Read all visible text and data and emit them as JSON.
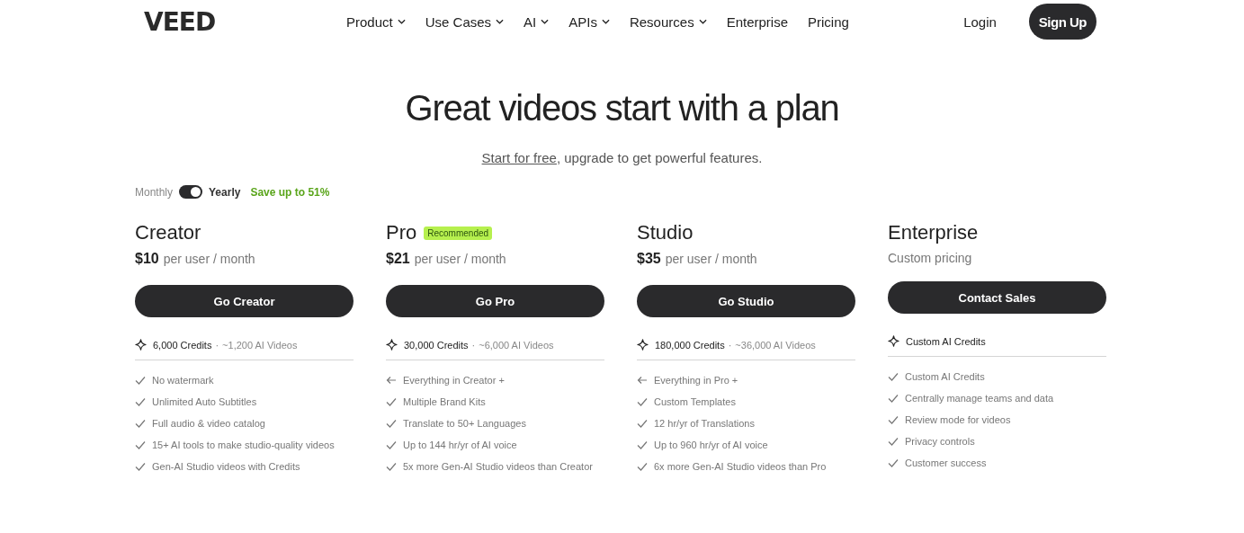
{
  "header": {
    "logo": "VEED",
    "nav": [
      {
        "label": "Product",
        "has_menu": true
      },
      {
        "label": "Use Cases",
        "has_menu": true
      },
      {
        "label": "AI",
        "has_menu": true
      },
      {
        "label": "APIs",
        "has_menu": true
      },
      {
        "label": "Resources",
        "has_menu": true
      },
      {
        "label": "Enterprise",
        "has_menu": false
      },
      {
        "label": "Pricing",
        "has_menu": false
      }
    ],
    "login": "Login",
    "signup": "Sign Up"
  },
  "hero": {
    "title": "Great videos start with a plan",
    "link": "Start for free",
    "subtitle_rest": ", upgrade to get powerful features."
  },
  "billing": {
    "monthly_label": "Monthly",
    "yearly_label": "Yearly",
    "yearly": true,
    "savings": "Save up to 51%"
  },
  "plans": [
    {
      "name": "Creator",
      "price": "$10",
      "price_unit": "per user / month",
      "button": "Go Creator",
      "credits": "6,000 Credits",
      "separator": "·",
      "videos": "~1,200 AI Videos",
      "features": [
        {
          "kind": "check",
          "text": "No watermark"
        },
        {
          "kind": "check",
          "text": "Unlimited Auto Subtitles"
        },
        {
          "kind": "check",
          "text": "Full audio & video catalog"
        },
        {
          "kind": "check",
          "text": "15+ AI tools to make studio-quality videos"
        },
        {
          "kind": "check",
          "text": "Gen-AI Studio videos with Credits"
        }
      ]
    },
    {
      "name": "Pro",
      "badge": "Recommended",
      "price": "$21",
      "price_unit": "per user / month",
      "button": "Go Pro",
      "credits": "30,000 Credits",
      "separator": "·",
      "videos": "~6,000 AI Videos",
      "features": [
        {
          "kind": "inherit",
          "text": "Everything in Creator +"
        },
        {
          "kind": "check",
          "text": "Multiple Brand Kits"
        },
        {
          "kind": "check",
          "text": "Translate to 50+ Languages"
        },
        {
          "kind": "check",
          "text": "Up to 144 hr/yr of AI voice"
        },
        {
          "kind": "check",
          "text": "5x more Gen-AI Studio videos than Creator"
        }
      ]
    },
    {
      "name": "Studio",
      "price": "$35",
      "price_unit": "per user / month",
      "button": "Go Studio",
      "credits": "180,000 Credits",
      "separator": "·",
      "videos": "~36,000 AI Videos",
      "features": [
        {
          "kind": "inherit",
          "text": "Everything in Pro +"
        },
        {
          "kind": "check",
          "text": "Custom Templates"
        },
        {
          "kind": "check",
          "text": "12 hr/yr of Translations"
        },
        {
          "kind": "check",
          "text": "Up to 960 hr/yr of AI voice"
        },
        {
          "kind": "check",
          "text": "6x more Gen-AI Studio videos than Pro"
        }
      ]
    },
    {
      "name": "Enterprise",
      "price_note": "Custom pricing",
      "button": "Contact Sales",
      "credits": "Custom AI Credits",
      "features": [
        {
          "kind": "check",
          "text": "Custom AI Credits"
        },
        {
          "kind": "check",
          "text": "Centrally manage teams and data"
        },
        {
          "kind": "check",
          "text": "Review mode for videos"
        },
        {
          "kind": "check",
          "text": "Privacy controls"
        },
        {
          "kind": "check",
          "text": "Customer success"
        }
      ]
    }
  ]
}
